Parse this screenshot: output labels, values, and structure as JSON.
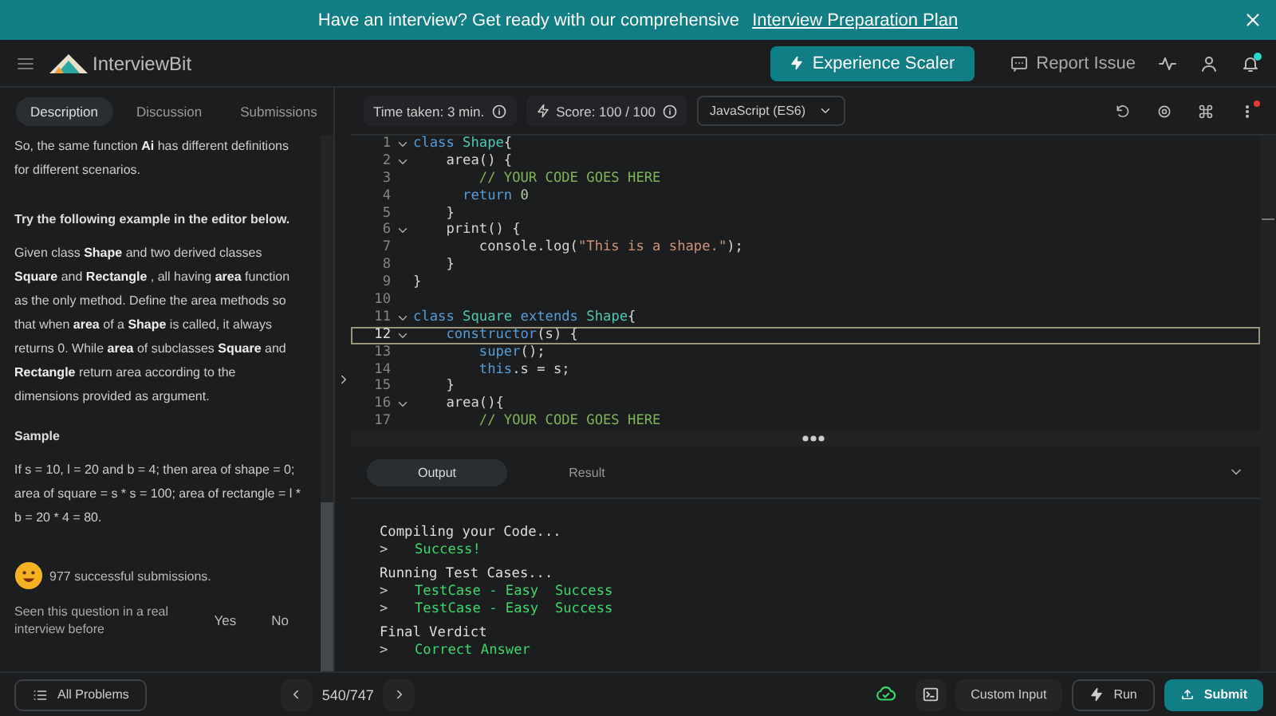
{
  "banner": {
    "text": "Have an interview? Get ready with our comprehensive",
    "link": "Interview Preparation Plan"
  },
  "header": {
    "logo": "InterviewBit",
    "cta": "Experience Scaler",
    "report": "Report Issue"
  },
  "problem_tabs": [
    {
      "label": "Description",
      "selected": true
    },
    {
      "label": "Discussion",
      "selected": false
    },
    {
      "label": "Submissions",
      "selected": false
    }
  ],
  "description": {
    "paragraphs": [
      {
        "kind": "text",
        "text": "So, the same function **Ai** has different definitions for different scenarios."
      },
      {
        "kind": "heading",
        "text": "Try the following example in the editor below."
      },
      {
        "kind": "text",
        "text": "Given class **Shape** and two derived classes **Square** and **Rectangle** , all having **area** function as the only method. Define the area methods so that when **area** of a **Shape** is called, it always returns 0. While **area** of subclasses **Square** and **Rectangle** return area according to the dimensions provided as argument."
      },
      {
        "kind": "heading",
        "text": "Sample"
      },
      {
        "kind": "text",
        "text": "If s = 10, l = 20 and b = 4; then area of shape = 0; area of square = s * s = 100; area of rectangle = l * b = 20 * 4 = 80."
      }
    ],
    "submissions": "977 successful submissions.",
    "seen": {
      "prompt": "Seen this question in a real interview before",
      "options": [
        "Yes",
        "No"
      ]
    }
  },
  "editor": {
    "time_taken": "Time taken: 3 min.",
    "score": "Score: 100 / 100",
    "language": "JavaScript (ES6)",
    "lines": [
      {
        "number": "1",
        "foldable": true,
        "current": false,
        "tokens": [
          {
            "kind": "keyword",
            "text": "class "
          },
          {
            "kind": "type",
            "text": "Shape"
          },
          {
            "kind": "plain",
            "text": "{"
          }
        ]
      },
      {
        "number": "2",
        "foldable": true,
        "current": false,
        "tokens": [
          {
            "kind": "plain",
            "text": "    area() {"
          }
        ]
      },
      {
        "number": "3",
        "foldable": false,
        "current": false,
        "tokens": [
          {
            "kind": "comment",
            "text": "        // YOUR CODE GOES HERE"
          }
        ]
      },
      {
        "number": "4",
        "foldable": false,
        "current": false,
        "tokens": [
          {
            "kind": "keyword",
            "text": "      return "
          },
          {
            "kind": "number",
            "text": "0"
          }
        ]
      },
      {
        "number": "5",
        "foldable": false,
        "current": false,
        "tokens": [
          {
            "kind": "plain",
            "text": "    }"
          }
        ]
      },
      {
        "number": "6",
        "foldable": true,
        "current": false,
        "tokens": [
          {
            "kind": "plain",
            "text": "    print() {"
          }
        ]
      },
      {
        "number": "7",
        "foldable": false,
        "current": false,
        "tokens": [
          {
            "kind": "plain",
            "text": "        console.log("
          },
          {
            "kind": "string",
            "text": "\"This is a shape.\""
          },
          {
            "kind": "plain",
            "text": ");"
          }
        ]
      },
      {
        "number": "8",
        "foldable": false,
        "current": false,
        "tokens": [
          {
            "kind": "plain",
            "text": "    }"
          }
        ]
      },
      {
        "number": "9",
        "foldable": false,
        "current": false,
        "tokens": [
          {
            "kind": "plain",
            "text": "}"
          }
        ]
      },
      {
        "number": "10",
        "foldable": false,
        "current": false
      },
      {
        "number": "11",
        "foldable": true,
        "current": false,
        "tokens": [
          {
            "kind": "keyword",
            "text": "class "
          },
          {
            "kind": "type",
            "text": "Square "
          },
          {
            "kind": "keyword",
            "text": "extends "
          },
          {
            "kind": "type",
            "text": "Shape"
          },
          {
            "kind": "plain",
            "text": "{"
          }
        ]
      },
      {
        "number": "12",
        "foldable": true,
        "current": true,
        "tokens": [
          {
            "kind": "keyword",
            "text": "    constructor"
          },
          {
            "kind": "plain",
            "text": "(s) {"
          }
        ]
      },
      {
        "number": "13",
        "foldable": false,
        "current": false,
        "tokens": [
          {
            "kind": "keyword",
            "text": "        super"
          },
          {
            "kind": "plain",
            "text": "();"
          }
        ]
      },
      {
        "number": "14",
        "foldable": false,
        "current": false,
        "tokens": [
          {
            "kind": "keyword",
            "text": "        this"
          },
          {
            "kind": "plain",
            "text": ".s = s;"
          }
        ]
      },
      {
        "number": "15",
        "foldable": false,
        "current": false,
        "tokens": [
          {
            "kind": "plain",
            "text": "    }"
          }
        ]
      },
      {
        "number": "16",
        "foldable": true,
        "current": false,
        "tokens": [
          {
            "kind": "plain",
            "text": "    area(){"
          }
        ]
      },
      {
        "number": "17",
        "foldable": false,
        "current": false,
        "tokens": [
          {
            "kind": "comment",
            "text": "        // YOUR CODE GOES HERE"
          }
        ]
      }
    ]
  },
  "output": {
    "tabs": [
      {
        "label": "Output",
        "selected": true
      },
      {
        "label": "Result",
        "selected": false
      }
    ],
    "groups": [
      {
        "heading": "Compiling your Code...",
        "results": [
          {
            "prompt": ">",
            "text": "Success!"
          }
        ]
      },
      {
        "heading": "Running Test Cases...",
        "results": [
          {
            "prompt": ">",
            "text": "TestCase - Easy  Success"
          },
          {
            "prompt": ">",
            "text": "TestCase - Easy  Success"
          }
        ]
      },
      {
        "heading": "Final Verdict",
        "results": [
          {
            "prompt": ">",
            "text": "Correct Answer"
          }
        ]
      }
    ]
  },
  "bottom": {
    "all_problems": "All Problems",
    "pager": "540/747",
    "custom_input": "Custom Input",
    "run": "Run",
    "submit": "Submit"
  }
}
